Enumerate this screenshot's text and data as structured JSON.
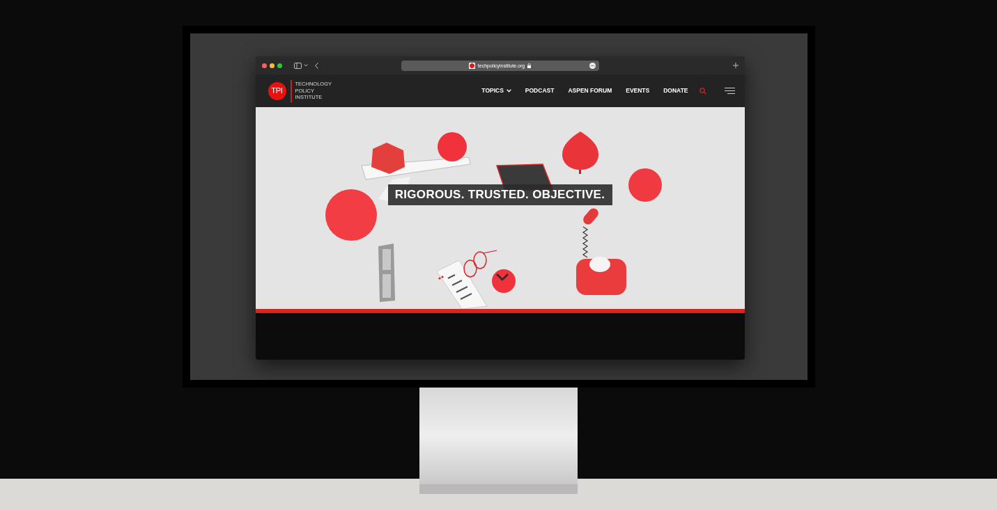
{
  "browser": {
    "url": "techpolicyinstitute.org"
  },
  "site": {
    "logo": {
      "mark": "TPI",
      "name_lines": [
        "TECHNOLOGY",
        "POLICY",
        "INSTITUTE"
      ]
    },
    "nav": [
      {
        "label": "TOPICS",
        "has_menu": true
      },
      {
        "label": "PODCAST",
        "has_menu": false
      },
      {
        "label": "ASPEN FORUM",
        "has_menu": false
      },
      {
        "label": "EVENTS",
        "has_menu": false
      },
      {
        "label": "DONATE",
        "has_menu": false
      }
    ],
    "hero": {
      "tagline": "RIGOROUS. TRUSTED. OBJECTIVE."
    }
  }
}
